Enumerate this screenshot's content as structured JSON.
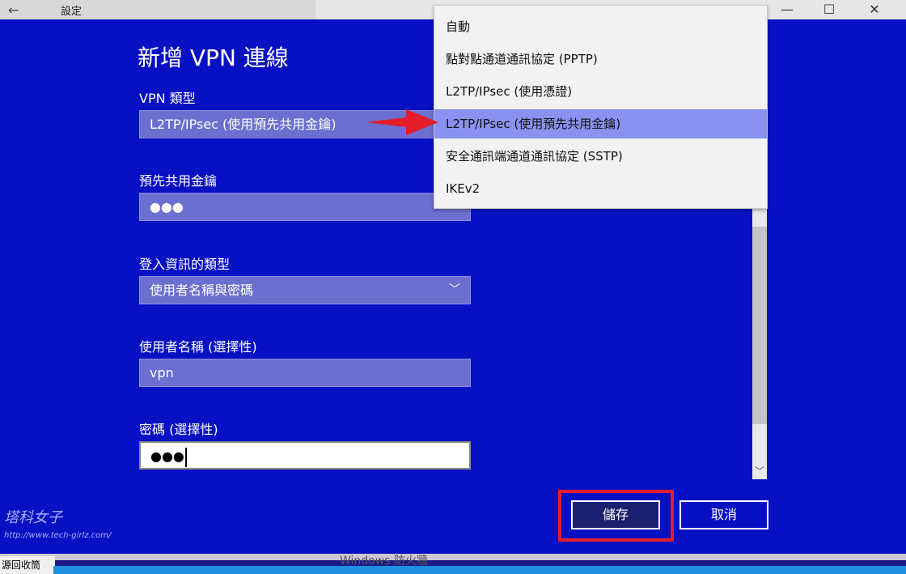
{
  "titlebar": {
    "back_icon": "←",
    "title": "設定",
    "minimize": "—",
    "maximize": "☐",
    "close": "✕"
  },
  "dialog": {
    "title": "新增 VPN 連線",
    "vpn_type": {
      "label": "VPN 類型",
      "value": "L2TP/IPsec (使用預先共用金鑰)"
    },
    "preshared_key": {
      "label": "預先共用金鑰",
      "value": "●●●"
    },
    "signin_type": {
      "label": "登入資訊的類型",
      "value": "使用者名稱與密碼",
      "chevron": "﹀"
    },
    "username": {
      "label": "使用者名稱 (選擇性)",
      "value": "vpn"
    },
    "password": {
      "label": "密碼 (選擇性)",
      "value": "●●●"
    },
    "save_label": "儲存",
    "cancel_label": "取消"
  },
  "dropdown": {
    "items": [
      "自動",
      "點對點通道通訊協定 (PPTP)",
      "L2TP/IPsec (使用憑證)",
      "L2TP/IPsec (使用預先共用金鑰)",
      "安全通訊端通道通訊協定 (SSTP)",
      "IKEv2"
    ],
    "selected_index": 3
  },
  "scrollbar": {
    "down_arrow": "﹀"
  },
  "annotations": {
    "arrow_color": "#e51c2a",
    "highlight_color": "#e51c2a"
  },
  "watermark": {
    "text": "塔科女子",
    "url": "http://www.tech-girlz.com/"
  },
  "background": {
    "left_text": "源回收筒",
    "mid_text": "Windows 防火牆"
  }
}
